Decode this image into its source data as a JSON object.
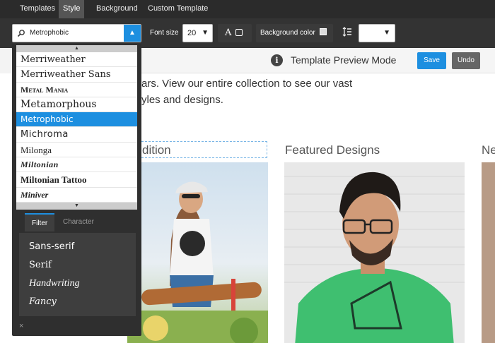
{
  "topbar": {
    "tabs": [
      {
        "label": "Templates"
      },
      {
        "label": "Style",
        "active": true
      },
      {
        "label": "Background"
      },
      {
        "label": "Custom Template"
      }
    ]
  },
  "toolbar": {
    "font_value": "Metrophobic",
    "font_size_label": "Font size",
    "font_size_value": "20",
    "text_style_label": "A",
    "bg_color_label": "Background color",
    "icons": [
      "search-icon",
      "chevron-down-icon",
      "line-spacing-icon"
    ]
  },
  "preview": {
    "title": "Template Preview Mode",
    "save_label": "Save",
    "undo_label": "Undo"
  },
  "content": {
    "intro_line1": "ars. View our entire collection to see our vast",
    "intro_line2": "yles and designs.",
    "sections": [
      {
        "title": "dition"
      },
      {
        "title": "Featured Designs"
      },
      {
        "title": "Ne"
      }
    ]
  },
  "font_panel": {
    "fonts": [
      {
        "label": "Merriweather"
      },
      {
        "label": "Merriweather Sans"
      },
      {
        "label": "Metal Mania"
      },
      {
        "label": "Metamorphous"
      },
      {
        "label": "Metrophobic",
        "selected": true
      },
      {
        "label": "Michroma"
      },
      {
        "label": "Milonga"
      },
      {
        "label": "Miltonian"
      },
      {
        "label": "Miltonian Tattoo"
      },
      {
        "label": "Miniver"
      }
    ],
    "tabs": [
      {
        "label": "Filter",
        "active": true
      },
      {
        "label": "Character"
      }
    ],
    "filters": [
      {
        "label": "Sans-serif"
      },
      {
        "label": "Serif"
      },
      {
        "label": "Handwriting"
      },
      {
        "label": "Fancy"
      }
    ],
    "close_label": "×"
  },
  "colors": {
    "accent": "#1d8fe0",
    "toolbar_bg": "#333333",
    "topbar_bg": "#2b2b2b"
  }
}
